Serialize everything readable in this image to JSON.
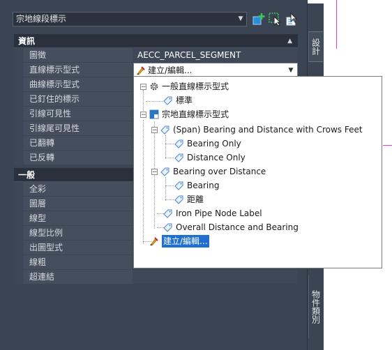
{
  "top_select": {
    "value": "宗地線段標示"
  },
  "tabs": {
    "design": "設計",
    "object_class": "物件類別"
  },
  "sections": {
    "info": {
      "label": "資訊",
      "rows": [
        {
          "name": "圖徵",
          "value": "AECC_PARCEL_SEGMENT"
        },
        {
          "name": "直線標示型式",
          "value": "建立/編輯..."
        },
        {
          "name": "曲線標示型式",
          "value": ""
        },
        {
          "name": "已釘住的標示",
          "value": ""
        },
        {
          "name": "引線可見性",
          "value": ""
        },
        {
          "name": "引線尾可見性",
          "value": ""
        },
        {
          "name": "已翻轉",
          "value": ""
        },
        {
          "name": "已反轉",
          "value": ""
        }
      ]
    },
    "general": {
      "label": "一般",
      "rows": [
        {
          "name": "全彩",
          "value": ""
        },
        {
          "name": "圖層",
          "value": ""
        },
        {
          "name": "線型",
          "value": ""
        },
        {
          "name": "線型比例",
          "value": ""
        },
        {
          "name": "出圖型式",
          "value": ""
        },
        {
          "name": "線粗",
          "value": ""
        },
        {
          "name": "超連結",
          "value": ""
        }
      ]
    }
  },
  "dropdown_tree": [
    {
      "label": "一般直線標示型式",
      "icon": "gear-icon"
    },
    {
      "label": "標準",
      "icon": "label-tag-icon"
    },
    {
      "label": "宗地直線標示型式",
      "icon": "parcel-style-icon"
    },
    {
      "label": "(Span)  Bearing and Distance with Crows Feet",
      "icon": "label-tag-icon"
    },
    {
      "label": "Bearing Only",
      "icon": "label-tag-icon"
    },
    {
      "label": "Distance Only",
      "icon": "label-tag-icon"
    },
    {
      "label": "Bearing over Distance",
      "icon": "label-tag-icon"
    },
    {
      "label": "Bearing",
      "icon": "label-tag-icon"
    },
    {
      "label": "距離",
      "icon": "label-tag-icon"
    },
    {
      "label": "Iron Pipe Node Label",
      "icon": "label-tag-icon"
    },
    {
      "label": "Overall Distance and Bearing",
      "icon": "label-tag-icon"
    },
    {
      "label": "建立/編輯...",
      "icon": "create-edit-icon"
    }
  ],
  "colors": {
    "selection": "#1e6fd0",
    "panel": "#3b4453",
    "accent_canvas_line": "#e040e0"
  }
}
